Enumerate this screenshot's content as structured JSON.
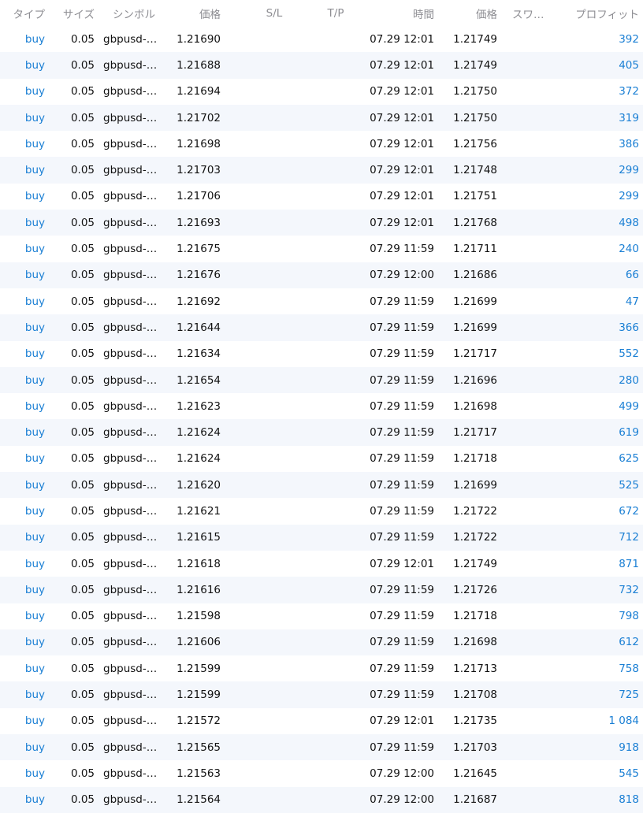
{
  "header": {
    "type": "タイプ",
    "size": "サイズ",
    "symbol": "シンボル",
    "open_price": "価格",
    "sl": "S/L",
    "tp": "T/P",
    "time": "時間",
    "close_price": "価格",
    "swap": "スワ…",
    "profit": "プロフィット"
  },
  "rows": [
    {
      "type": "buy",
      "size": "0.05",
      "symbol": "gbpusd-…",
      "open_price": "1.21690",
      "sl": "",
      "tp": "",
      "time": "07.29 12:01",
      "close_price": "1.21749",
      "swap": "",
      "profit": "392"
    },
    {
      "type": "buy",
      "size": "0.05",
      "symbol": "gbpusd-…",
      "open_price": "1.21688",
      "sl": "",
      "tp": "",
      "time": "07.29 12:01",
      "close_price": "1.21749",
      "swap": "",
      "profit": "405"
    },
    {
      "type": "buy",
      "size": "0.05",
      "symbol": "gbpusd-…",
      "open_price": "1.21694",
      "sl": "",
      "tp": "",
      "time": "07.29 12:01",
      "close_price": "1.21750",
      "swap": "",
      "profit": "372"
    },
    {
      "type": "buy",
      "size": "0.05",
      "symbol": "gbpusd-…",
      "open_price": "1.21702",
      "sl": "",
      "tp": "",
      "time": "07.29 12:01",
      "close_price": "1.21750",
      "swap": "",
      "profit": "319"
    },
    {
      "type": "buy",
      "size": "0.05",
      "symbol": "gbpusd-…",
      "open_price": "1.21698",
      "sl": "",
      "tp": "",
      "time": "07.29 12:01",
      "close_price": "1.21756",
      "swap": "",
      "profit": "386"
    },
    {
      "type": "buy",
      "size": "0.05",
      "symbol": "gbpusd-…",
      "open_price": "1.21703",
      "sl": "",
      "tp": "",
      "time": "07.29 12:01",
      "close_price": "1.21748",
      "swap": "",
      "profit": "299"
    },
    {
      "type": "buy",
      "size": "0.05",
      "symbol": "gbpusd-…",
      "open_price": "1.21706",
      "sl": "",
      "tp": "",
      "time": "07.29 12:01",
      "close_price": "1.21751",
      "swap": "",
      "profit": "299"
    },
    {
      "type": "buy",
      "size": "0.05",
      "symbol": "gbpusd-…",
      "open_price": "1.21693",
      "sl": "",
      "tp": "",
      "time": "07.29 12:01",
      "close_price": "1.21768",
      "swap": "",
      "profit": "498"
    },
    {
      "type": "buy",
      "size": "0.05",
      "symbol": "gbpusd-…",
      "open_price": "1.21675",
      "sl": "",
      "tp": "",
      "time": "07.29 11:59",
      "close_price": "1.21711",
      "swap": "",
      "profit": "240"
    },
    {
      "type": "buy",
      "size": "0.05",
      "symbol": "gbpusd-…",
      "open_price": "1.21676",
      "sl": "",
      "tp": "",
      "time": "07.29 12:00",
      "close_price": "1.21686",
      "swap": "",
      "profit": "66"
    },
    {
      "type": "buy",
      "size": "0.05",
      "symbol": "gbpusd-…",
      "open_price": "1.21692",
      "sl": "",
      "tp": "",
      "time": "07.29 11:59",
      "close_price": "1.21699",
      "swap": "",
      "profit": "47"
    },
    {
      "type": "buy",
      "size": "0.05",
      "symbol": "gbpusd-…",
      "open_price": "1.21644",
      "sl": "",
      "tp": "",
      "time": "07.29 11:59",
      "close_price": "1.21699",
      "swap": "",
      "profit": "366"
    },
    {
      "type": "buy",
      "size": "0.05",
      "symbol": "gbpusd-…",
      "open_price": "1.21634",
      "sl": "",
      "tp": "",
      "time": "07.29 11:59",
      "close_price": "1.21717",
      "swap": "",
      "profit": "552"
    },
    {
      "type": "buy",
      "size": "0.05",
      "symbol": "gbpusd-…",
      "open_price": "1.21654",
      "sl": "",
      "tp": "",
      "time": "07.29 11:59",
      "close_price": "1.21696",
      "swap": "",
      "profit": "280"
    },
    {
      "type": "buy",
      "size": "0.05",
      "symbol": "gbpusd-…",
      "open_price": "1.21623",
      "sl": "",
      "tp": "",
      "time": "07.29 11:59",
      "close_price": "1.21698",
      "swap": "",
      "profit": "499"
    },
    {
      "type": "buy",
      "size": "0.05",
      "symbol": "gbpusd-…",
      "open_price": "1.21624",
      "sl": "",
      "tp": "",
      "time": "07.29 11:59",
      "close_price": "1.21717",
      "swap": "",
      "profit": "619"
    },
    {
      "type": "buy",
      "size": "0.05",
      "symbol": "gbpusd-…",
      "open_price": "1.21624",
      "sl": "",
      "tp": "",
      "time": "07.29 11:59",
      "close_price": "1.21718",
      "swap": "",
      "profit": "625"
    },
    {
      "type": "buy",
      "size": "0.05",
      "symbol": "gbpusd-…",
      "open_price": "1.21620",
      "sl": "",
      "tp": "",
      "time": "07.29 11:59",
      "close_price": "1.21699",
      "swap": "",
      "profit": "525"
    },
    {
      "type": "buy",
      "size": "0.05",
      "symbol": "gbpusd-…",
      "open_price": "1.21621",
      "sl": "",
      "tp": "",
      "time": "07.29 11:59",
      "close_price": "1.21722",
      "swap": "",
      "profit": "672"
    },
    {
      "type": "buy",
      "size": "0.05",
      "symbol": "gbpusd-…",
      "open_price": "1.21615",
      "sl": "",
      "tp": "",
      "time": "07.29 11:59",
      "close_price": "1.21722",
      "swap": "",
      "profit": "712"
    },
    {
      "type": "buy",
      "size": "0.05",
      "symbol": "gbpusd-…",
      "open_price": "1.21618",
      "sl": "",
      "tp": "",
      "time": "07.29 12:01",
      "close_price": "1.21749",
      "swap": "",
      "profit": "871"
    },
    {
      "type": "buy",
      "size": "0.05",
      "symbol": "gbpusd-…",
      "open_price": "1.21616",
      "sl": "",
      "tp": "",
      "time": "07.29 11:59",
      "close_price": "1.21726",
      "swap": "",
      "profit": "732"
    },
    {
      "type": "buy",
      "size": "0.05",
      "symbol": "gbpusd-…",
      "open_price": "1.21598",
      "sl": "",
      "tp": "",
      "time": "07.29 11:59",
      "close_price": "1.21718",
      "swap": "",
      "profit": "798"
    },
    {
      "type": "buy",
      "size": "0.05",
      "symbol": "gbpusd-…",
      "open_price": "1.21606",
      "sl": "",
      "tp": "",
      "time": "07.29 11:59",
      "close_price": "1.21698",
      "swap": "",
      "profit": "612"
    },
    {
      "type": "buy",
      "size": "0.05",
      "symbol": "gbpusd-…",
      "open_price": "1.21599",
      "sl": "",
      "tp": "",
      "time": "07.29 11:59",
      "close_price": "1.21713",
      "swap": "",
      "profit": "758"
    },
    {
      "type": "buy",
      "size": "0.05",
      "symbol": "gbpusd-…",
      "open_price": "1.21599",
      "sl": "",
      "tp": "",
      "time": "07.29 11:59",
      "close_price": "1.21708",
      "swap": "",
      "profit": "725"
    },
    {
      "type": "buy",
      "size": "0.05",
      "symbol": "gbpusd-…",
      "open_price": "1.21572",
      "sl": "",
      "tp": "",
      "time": "07.29 12:01",
      "close_price": "1.21735",
      "swap": "",
      "profit": "1 084"
    },
    {
      "type": "buy",
      "size": "0.05",
      "symbol": "gbpusd-…",
      "open_price": "1.21565",
      "sl": "",
      "tp": "",
      "time": "07.29 11:59",
      "close_price": "1.21703",
      "swap": "",
      "profit": "918"
    },
    {
      "type": "buy",
      "size": "0.05",
      "symbol": "gbpusd-…",
      "open_price": "1.21563",
      "sl": "",
      "tp": "",
      "time": "07.29 12:00",
      "close_price": "1.21645",
      "swap": "",
      "profit": "545"
    },
    {
      "type": "buy",
      "size": "0.05",
      "symbol": "gbpusd-…",
      "open_price": "1.21564",
      "sl": "",
      "tp": "",
      "time": "07.29 12:00",
      "close_price": "1.21687",
      "swap": "",
      "profit": "818"
    }
  ]
}
